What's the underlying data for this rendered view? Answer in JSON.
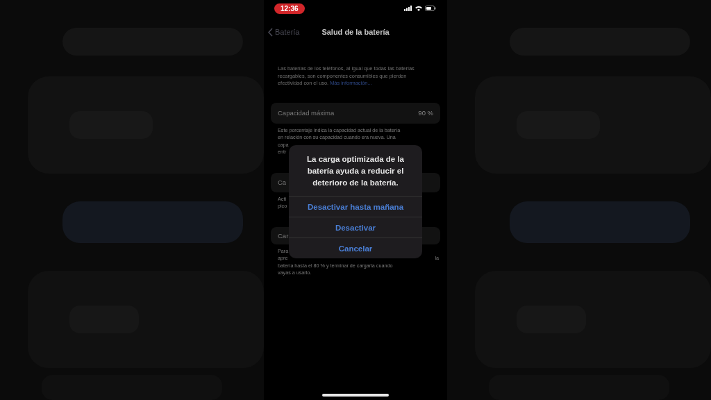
{
  "status_bar": {
    "time": "12:36"
  },
  "nav": {
    "back": "Batería",
    "title": "Salud de la batería"
  },
  "intro": {
    "text": "Las baterías de los teléfonos, al igual que todas las baterías recargables, son componentes consumibles que pierden efectividad con el uso.",
    "link": "Más información..."
  },
  "sections": [
    {
      "row": {
        "label": "Capacidad máxima",
        "value": "90 %"
      },
      "footnote": [
        [
          "Este porcentaje indica la capacidad actual de la batería"
        ],
        [
          "en relación con su capacidad cuando era nueva. Una"
        ],
        [
          "capa"
        ],
        [
          "entr"
        ]
      ]
    },
    {
      "row": {
        "label": "Ca"
      },
      "footnote": [
        [
          "Acti"
        ],
        [
          "pico"
        ]
      ]
    },
    {
      "row": {
        "label": "Car"
      },
      "footnote": [
        [
          "Para"
        ],
        [
          "apre",
          "la"
        ],
        [
          "batería hasta el 80 % y terminar de cargarla cuando"
        ],
        [
          "vayas a usarlo."
        ]
      ]
    }
  ],
  "alert": {
    "message": "La carga optimizada de la batería ayuda a reducir el deterioro de la batería.",
    "actions": [
      "Desactivar hasta mañana",
      "Desactivar",
      "Cancelar"
    ]
  }
}
